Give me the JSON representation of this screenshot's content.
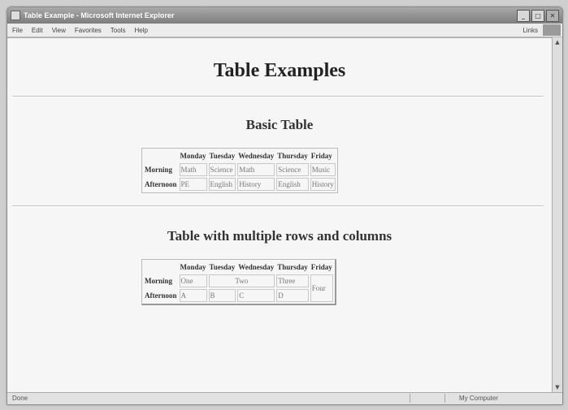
{
  "window": {
    "title": "Table Example - Microsoft Internet Explorer"
  },
  "menu": [
    "File",
    "Edit",
    "View",
    "Favorites",
    "Tools",
    "Help"
  ],
  "links_label": "Links",
  "page": {
    "heading": "Table Examples",
    "basic": {
      "title": "Basic Table",
      "headers": [
        "Monday",
        "Tuesday",
        "Wednesday",
        "Thursday",
        "Friday"
      ],
      "rows": [
        {
          "label": "Morning",
          "cells": [
            "Math",
            "Science",
            "Math",
            "Science",
            "Music"
          ]
        },
        {
          "label": "Afternoon",
          "cells": [
            "PE",
            "English",
            "History",
            "English",
            "History"
          ]
        }
      ]
    },
    "multi": {
      "title": "Table with multiple rows and columns",
      "headers": [
        "Monday",
        "Tuesday",
        "Wednesday",
        "Thursday",
        "Friday"
      ],
      "morning_label": "Morning",
      "afternoon_label": "Afternoon",
      "cells": {
        "one": "One",
        "two": "Two",
        "three": "Three",
        "four": "Four",
        "a": "A",
        "b": "B",
        "c": "C",
        "d": "D"
      }
    }
  },
  "status": {
    "left": "Done",
    "zone": "My Computer"
  }
}
